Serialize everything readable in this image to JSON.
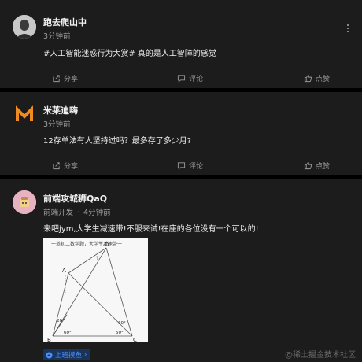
{
  "posts": [
    {
      "author": "跑去爬山中",
      "time": "3分钟前",
      "content": "#人工智能迷惑行为大赏# 真的是人工智障的感觉",
      "actions": {
        "share": "分享",
        "comment": "评论",
        "like": "点赞"
      }
    },
    {
      "author": "米莱迪嗨",
      "time": "3分钟前",
      "content": "12存单法有人坚持过吗？最多存了多少月?",
      "actions": {
        "share": "分享",
        "comment": "评论",
        "like": "点赞"
      }
    },
    {
      "author": "前端攻城狮QaQ",
      "role": "前端开发",
      "separator": "·",
      "time": "4分钟前",
      "content": "来吧jym,大学生减速带!不服来试!在座的各位没有一个可以的!",
      "image": {
        "caption": "一道初二数学题，大学生减速带一",
        "labels": {
          "A": "A",
          "B": "B",
          "C": "C",
          "D": "D",
          "q": "?"
        },
        "angles": {
          "b_top": "20°",
          "b_bottom": "60°",
          "c_top": "30°",
          "c_bottom": "50°"
        }
      },
      "tag": "上班摸鱼",
      "tag_suffix": "›"
    }
  ],
  "watermark": "@稀土掘金技术社区",
  "colors": {
    "card_bg": "#1c1c1c",
    "page_bg": "#000000",
    "tag_bg": "#18345b",
    "tag_fg": "#4e8ef7",
    "m_logo": "#f08c1e"
  },
  "icons": [
    "share-icon",
    "comment-icon",
    "like-icon",
    "more-icon",
    "fish-icon"
  ]
}
